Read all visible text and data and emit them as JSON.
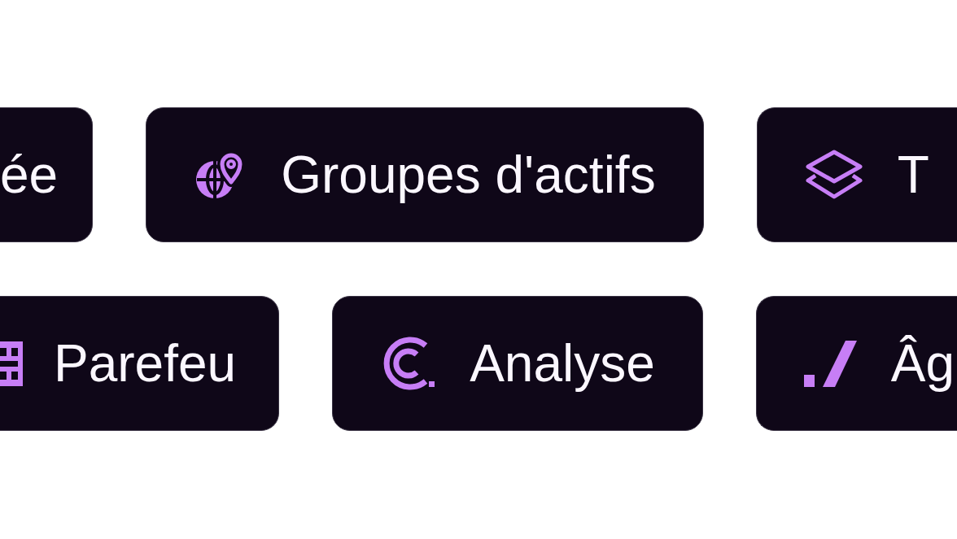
{
  "tag_rows": [
    {
      "tags": [
        "ée",
        "Groupes d'actifs",
        "T"
      ]
    },
    {
      "tags": [
        "Parefeu",
        "Analyse",
        "Âg"
      ]
    }
  ]
}
